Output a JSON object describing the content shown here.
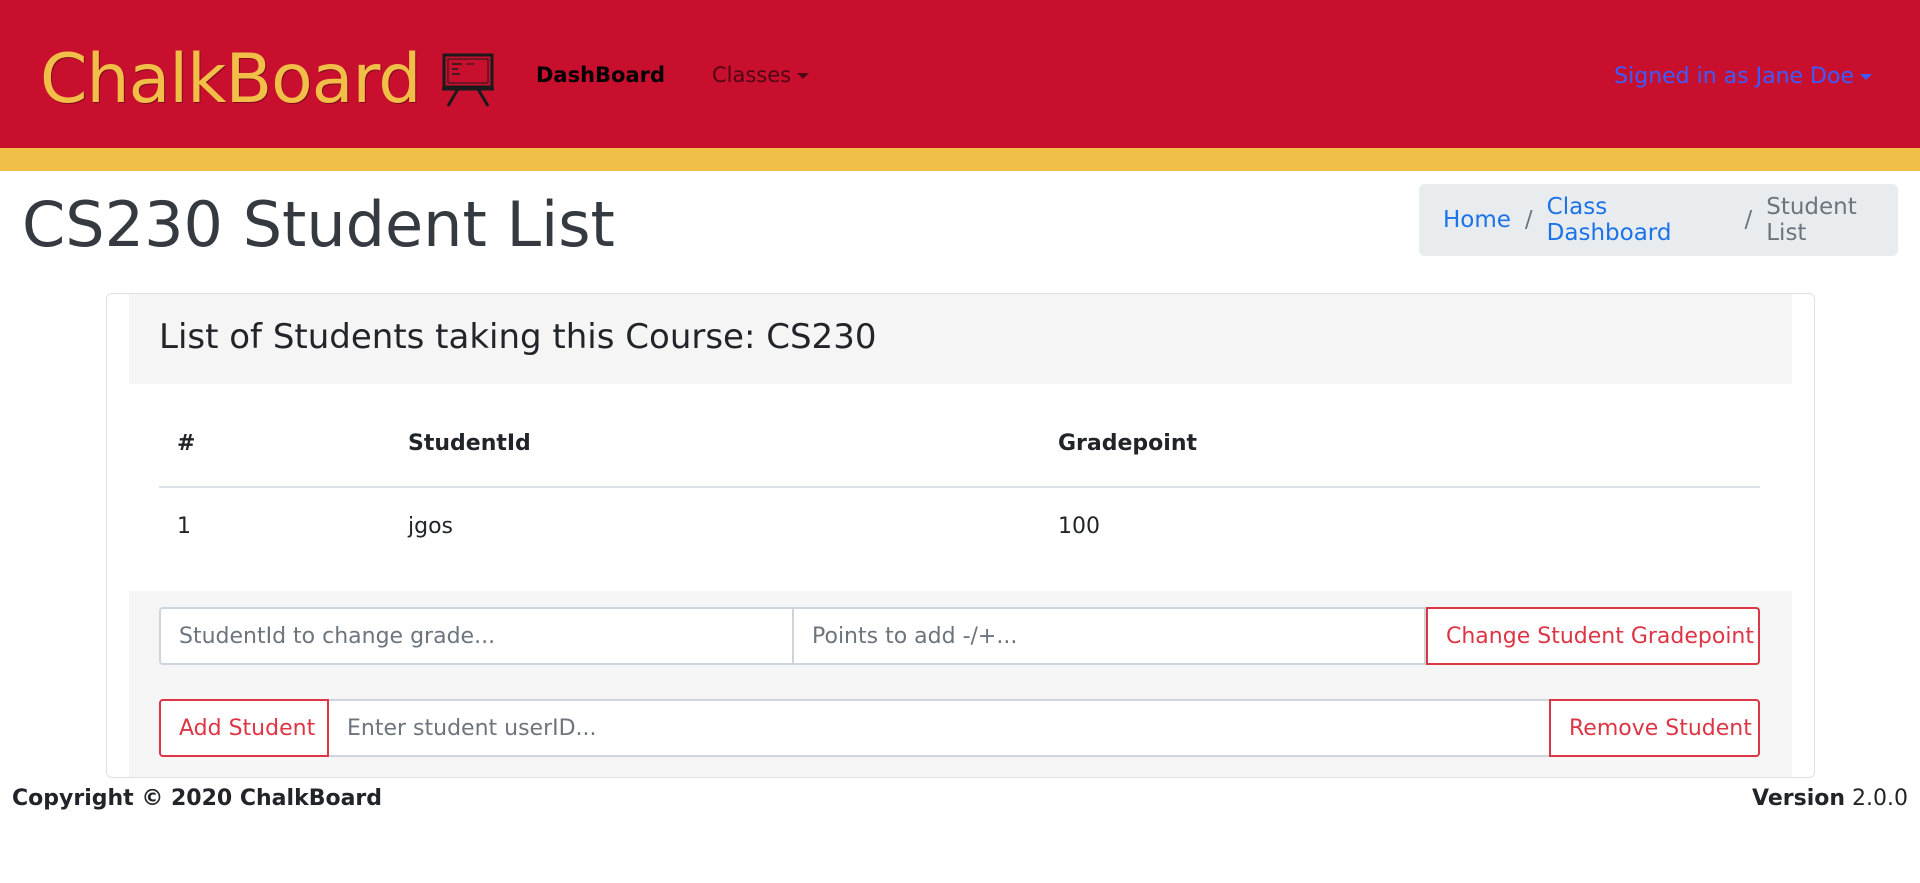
{
  "navbar": {
    "brand": "ChalkBoard",
    "brand_icon": "chalkboard-icon",
    "dashboard_label": "DashBoard",
    "classes_label": "Classes",
    "user_label": "Signed in as Jane Doe",
    "colors": {
      "primary": "#c8102e",
      "accent": "#f1be48",
      "user_link": "#3b5bff"
    }
  },
  "page": {
    "title": "CS230 Student List"
  },
  "breadcrumb": {
    "items": [
      {
        "label": "Home"
      },
      {
        "label": "Class Dashboard"
      },
      {
        "label": "Student List"
      }
    ],
    "separator": "/"
  },
  "card": {
    "title": "List of Students taking this Course: CS230"
  },
  "table": {
    "headers": [
      "#",
      "StudentId",
      "Gradepoint"
    ],
    "rows": [
      [
        "1",
        "jgos",
        "100"
      ]
    ]
  },
  "grade_form": {
    "studentid_placeholder": "StudentId to change grade...",
    "points_placeholder": "Points to add -/+...",
    "change_button": "Change Student Gradepoint"
  },
  "student_form": {
    "add_button": "Add Student",
    "userid_placeholder": "Enter student userID...",
    "remove_button": "Remove Student"
  },
  "footer": {
    "copyright": "Copyright © 2020 ChalkBoard",
    "version_label": "Version",
    "version_value": "2.0.0"
  }
}
